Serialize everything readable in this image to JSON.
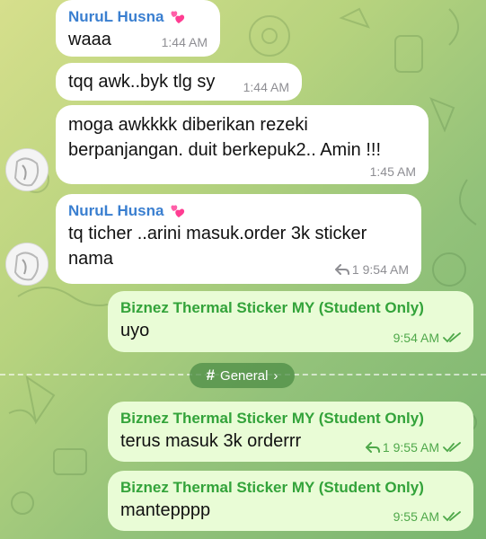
{
  "messages": [
    {
      "sender": "NuruL Husna",
      "text": "waaa",
      "time": "1:44 AM"
    },
    {
      "text": "tqq awk..byk tlg sy",
      "time": "1:44 AM"
    },
    {
      "text_line1": "moga awkkkk diberikan rezeki",
      "text_line2": "berpanjangan. duit berkepuk2.. Amin !!!",
      "time": "1:45 AM"
    },
    {
      "sender": "NuruL Husna",
      "text_line1": "tq ticher ..arini masuk.order 3k sticker",
      "text_line2": "nama",
      "reply_count": "1",
      "time": "9:54 AM"
    },
    {
      "sender": "Biznez Thermal Sticker MY (Student Only)",
      "text": "uyo",
      "time": "9:54 AM"
    },
    {
      "sender": "Biznez Thermal Sticker MY (Student Only)",
      "text": "terus masuk 3k orderrr",
      "reply_count": "1",
      "time": "9:55 AM"
    },
    {
      "sender": "Biznez Thermal Sticker MY (Student Only)",
      "text": "mantepppp",
      "time": "9:55 AM"
    }
  ],
  "topic": {
    "hash": "#",
    "label": "General",
    "chevron": "›"
  },
  "icons": {
    "heart": "two-hearts-icon",
    "reply": "reply-arrow-icon",
    "read": "double-check-icon",
    "avatar": "user-avatar"
  },
  "colors": {
    "incoming_name": "#3a7fd0",
    "outgoing_name": "#33a33a",
    "outgoing_bubble": "#e9fcd6",
    "time_out": "#4fa84a"
  }
}
